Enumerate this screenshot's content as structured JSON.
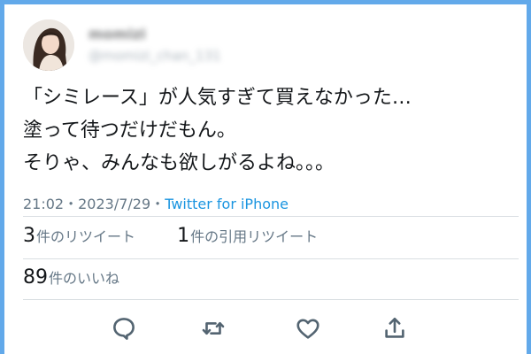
{
  "user": {
    "display_name": "momizi",
    "handle": "@momizi_chan_131"
  },
  "tweet": {
    "lines": [
      "「シミレース」が人気すぎて買えなかった…",
      "塗って待つだけだもん。",
      "そりゃ、みんなも欲しがるよね。。。"
    ]
  },
  "meta": {
    "time": "21:02",
    "separator1": "・",
    "date": "2023/7/29",
    "separator2": "・",
    "source": "Twitter for iPhone"
  },
  "stats": {
    "retweets_count": "3",
    "retweets_label": "件のリツイート",
    "quotes_count": "1",
    "quotes_label": "件の引用リツイート",
    "likes_count": "89",
    "likes_label": "件のいいね"
  },
  "colors": {
    "background": "#62a9ea",
    "text": "#14171a",
    "muted": "#657786",
    "link": "#1b95e0",
    "icon": "#536471"
  },
  "icons": {
    "reply": "reply-icon",
    "retweet": "retweet-icon",
    "like": "heart-icon",
    "share": "share-icon"
  }
}
